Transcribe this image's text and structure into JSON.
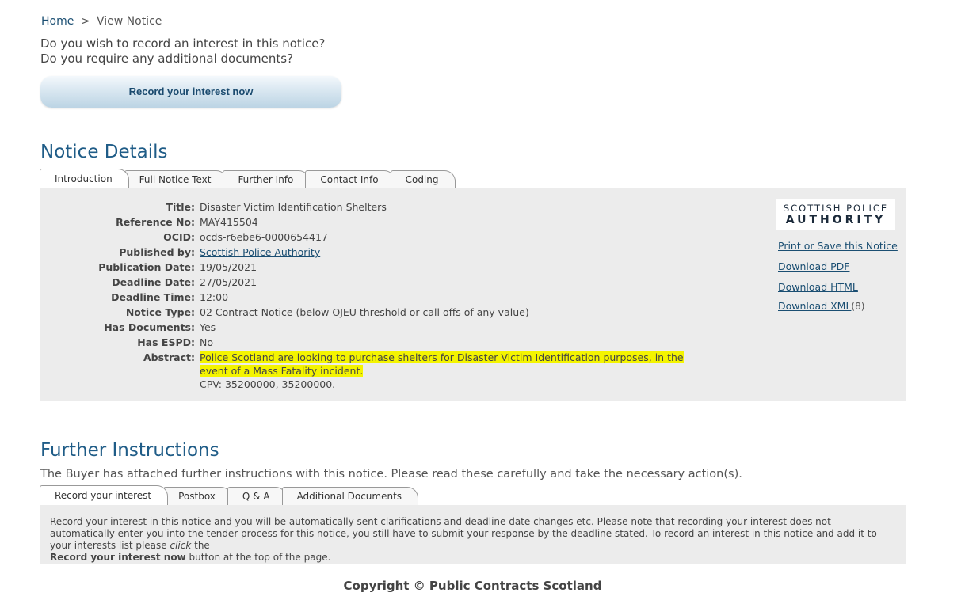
{
  "breadcrumb": {
    "home": "Home",
    "separator": ">",
    "current": "View Notice"
  },
  "prompt": {
    "line1": "Do you wish to record an interest in this notice?",
    "line2": "Do you require any additional documents?",
    "button": "Record your interest now"
  },
  "notice_details": {
    "title": "Notice Details",
    "tabs": [
      "Introduction",
      "Full Notice Text",
      "Further Info",
      "Contact Info",
      "Coding"
    ],
    "fields": [
      {
        "label": "Title:",
        "value": "Disaster Victim Identification Shelters"
      },
      {
        "label": "Reference No:",
        "value": "MAY415504"
      },
      {
        "label": "OCID:",
        "value": "ocds-r6ebe6-0000654417"
      },
      {
        "label": "Published by:",
        "value": "Scottish Police Authority"
      },
      {
        "label": "Publication Date:",
        "value": "19/05/2021"
      },
      {
        "label": "Deadline Date:",
        "value": "27/05/2021"
      },
      {
        "label": "Deadline Time:",
        "value": "12:00"
      },
      {
        "label": "Notice Type:",
        "value": "02 Contract Notice (below OJEU threshold or call offs of any value)"
      },
      {
        "label": "Has Documents:",
        "value": "Yes"
      },
      {
        "label": "Has ESPD:",
        "value": "No"
      }
    ],
    "abstract": {
      "label": "Abstract:",
      "line1": "Police Scotland are looking to purchase shelters for Disaster Victim Identification purposes, in the",
      "line2": "event of a Mass Fatality incident.",
      "cpv": "CPV: 35200000, 35200000."
    },
    "logo": {
      "line1": "SCOTTISH POLICE",
      "line2": "AUTHORITY"
    },
    "side_links": {
      "print": "Print or Save this Notice",
      "pdf": "Download PDF",
      "html": "Download HTML",
      "xml": "Download XML",
      "xml_count": "(8)"
    }
  },
  "further_instructions": {
    "title": "Further Instructions",
    "intro": "The Buyer has attached further instructions with this notice. Please read these carefully and take the necessary action(s).",
    "tabs": [
      "Record your interest",
      "Postbox",
      "Q & A",
      "Additional Documents"
    ],
    "text_part1": "Record your interest in this notice and you will be automatically sent clarifications and deadline date changes etc. Please note that recording your interest does not automatically enter you into the tender process for this notice, you still have to submit your response by the deadline stated. To record an interest in this notice and add it to your interests list please ",
    "text_click": "click",
    "text_part2": " the ",
    "text_bold": "Record your interest now",
    "text_part3": " button at the top of the page."
  },
  "footer": {
    "copyright": "Copyright © Public Contracts Scotland"
  }
}
